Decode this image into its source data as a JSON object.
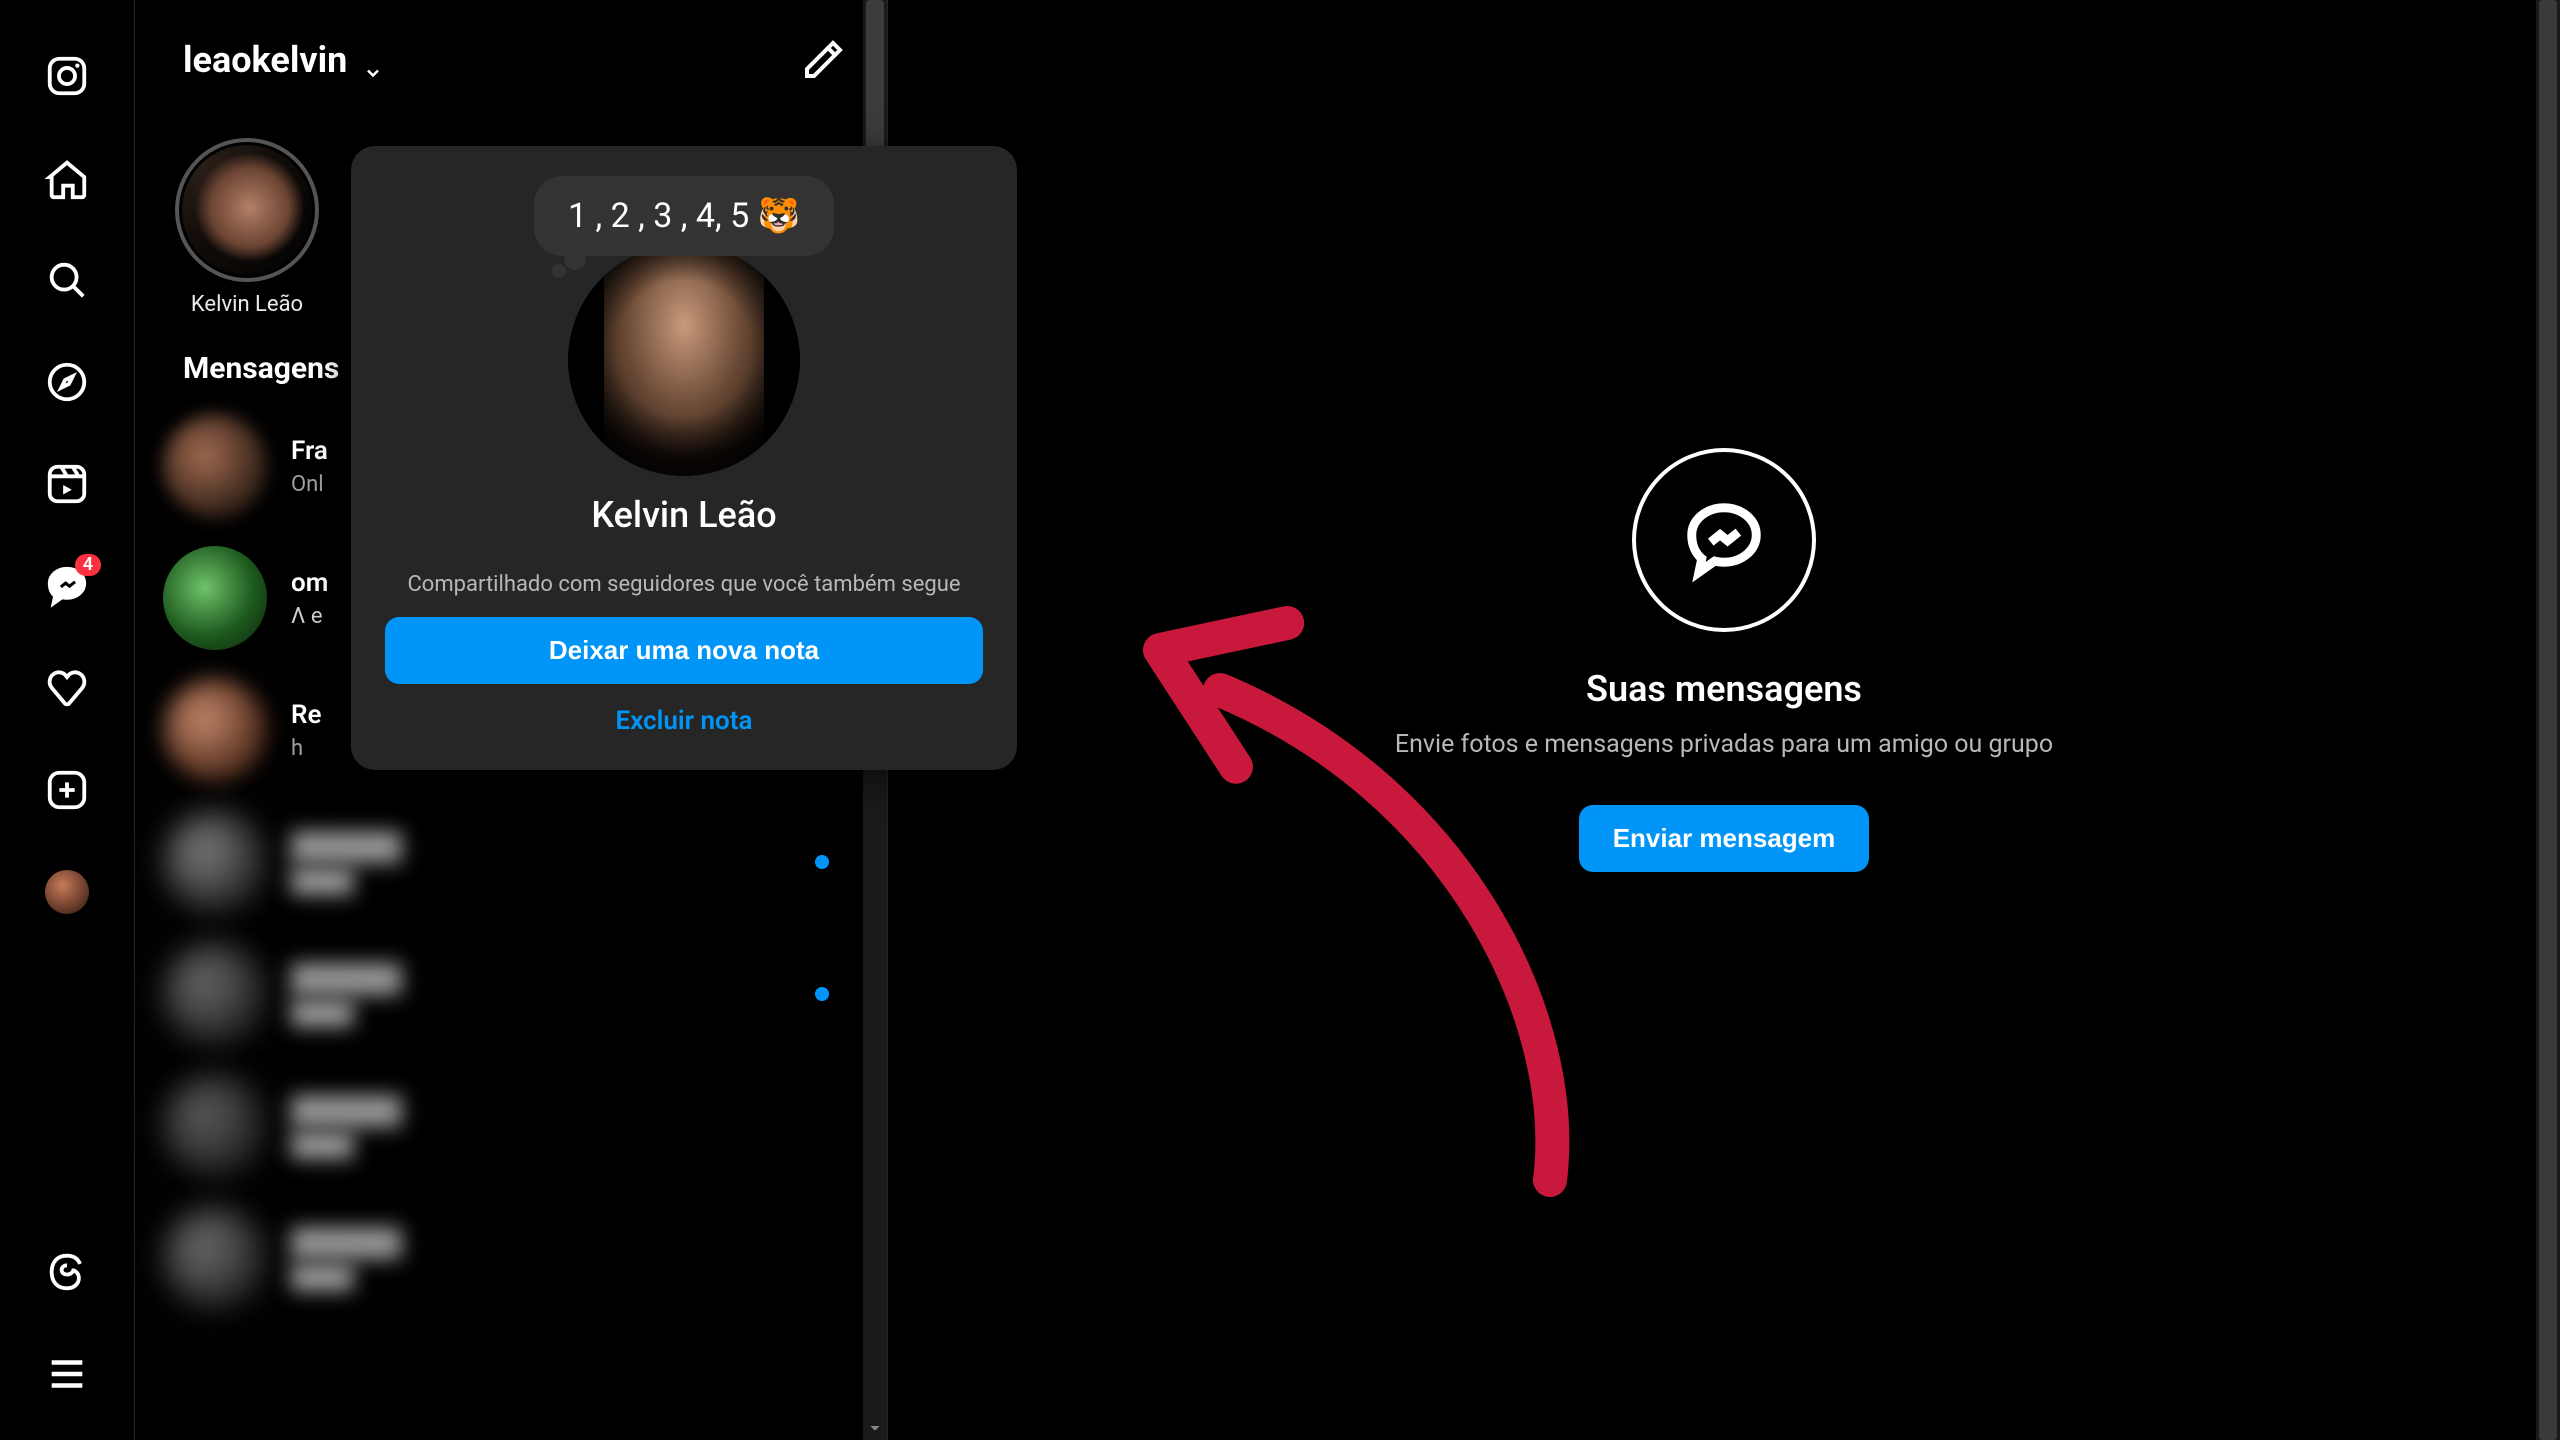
{
  "colors": {
    "accent": "#0095f6",
    "annotation": "#c8183c",
    "badge": "#ff3040"
  },
  "rail": {
    "badge_count": "4"
  },
  "inbox": {
    "username": "leaokelvin",
    "section_messages": "Mensagens",
    "notes": {
      "self": {
        "label": "Kelvin Leão"
      }
    },
    "chats": [
      {
        "name": "Fra",
        "sub_status": "Onl"
      },
      {
        "name": "om",
        "sub_snippet": "Λ e"
      },
      {
        "name": "Re",
        "sub_time": "h"
      }
    ]
  },
  "modal": {
    "note_text": "1 , 2 , 3 , 4, 5 🐯",
    "name": "Kelvin Leão",
    "desc": "Compartilhado com seguidores que você também segue",
    "primary_label": "Deixar uma nova nota",
    "secondary_label": "Excluir nota"
  },
  "empty_state": {
    "title": "Suas mensagens",
    "subtitle": "Envie fotos e mensagens privadas para um amigo ou grupo",
    "button": "Enviar mensagem"
  }
}
